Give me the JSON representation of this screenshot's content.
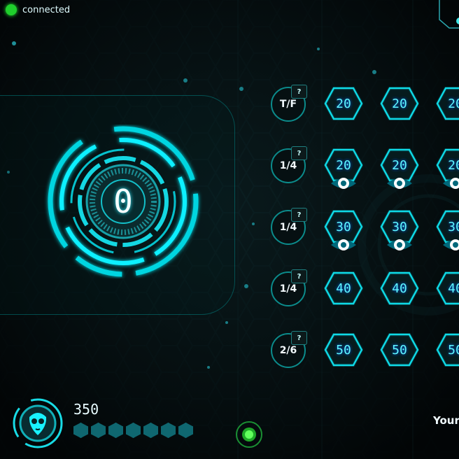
{
  "status": {
    "text": "connected",
    "color": "#1fcf2c"
  },
  "timer": {
    "value": "0"
  },
  "board": [
    {
      "category": "T/F",
      "help": "?",
      "tiles": [
        "20",
        "20",
        "20"
      ],
      "eyes": [
        false,
        false,
        false
      ]
    },
    {
      "category": "1/4",
      "help": "?",
      "tiles": [
        "20",
        "20",
        "20"
      ],
      "eyes": [
        true,
        true,
        true
      ]
    },
    {
      "category": "1/4",
      "help": "?",
      "tiles": [
        "30",
        "30",
        "30"
      ],
      "eyes": [
        true,
        true,
        true
      ]
    },
    {
      "category": "1/4",
      "help": "?",
      "tiles": [
        "40",
        "40",
        "40"
      ],
      "eyes": [
        false,
        false,
        false
      ]
    },
    {
      "category": "2/6",
      "help": "?",
      "tiles": [
        "50",
        "50",
        "50"
      ],
      "eyes": [
        false,
        false,
        false
      ]
    }
  ],
  "player": {
    "score": "350",
    "lives": 7,
    "label": "Your"
  },
  "theme": {
    "accent": "#19e8ff",
    "glow": "#00d5e0",
    "background": "#050b0c",
    "status": "#1fcf2c"
  },
  "icons": {
    "profile": "alien-face-icon",
    "help": "question-mark-icon",
    "eye": "eye-icon",
    "pulse": "green-orb-icon"
  }
}
